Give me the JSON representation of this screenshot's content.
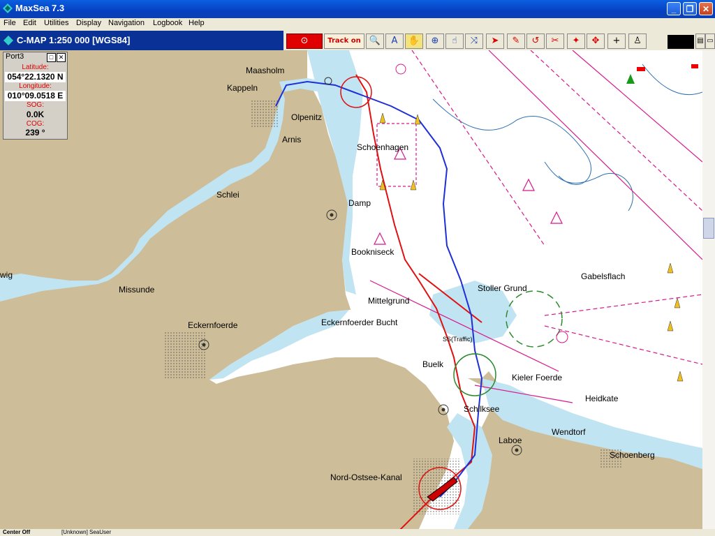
{
  "app": {
    "title": "MaxSea 7.3"
  },
  "menu": [
    "File",
    "Edit",
    "Utilities",
    "Display",
    "Navigation",
    "Logbook",
    "Help"
  ],
  "chart": {
    "header": "C-MAP  1:250 000 [WGS84]"
  },
  "toolbar": {
    "track_label": "Track on"
  },
  "port": {
    "name": "Port3",
    "latitude_label": "Latitude:",
    "latitude": "054°22.1320 N",
    "longitude_label": "Longitude:",
    "longitude": "010°09.0518 E",
    "sog_label": "SOG:",
    "sog": "0.0K",
    "cog_label": "COG:",
    "cog": "239 °"
  },
  "places": [
    "Maasholm",
    "Kappeln",
    "Olpenitz",
    "Arnis",
    "Schoenhagen",
    "Schlei",
    "Damp",
    "Bookniseck",
    "Missunde",
    "Eckernfoerde",
    "Mittelgrund",
    "Eckernfoerder Bucht",
    "Stoller Grund",
    "Gabelsflach",
    "Buelk",
    "Kieler Foerde",
    "Heidkate",
    "Schilksee",
    "Wendtorf",
    "Laboe",
    "Schoenberg",
    "Nord-Ostsee-Kanal",
    "wig",
    "SS(Traffic)"
  ],
  "status": {
    "left": "Center Off",
    "user": "[Unknown] SeaUser"
  },
  "colors": {
    "land": "#cdbd98",
    "deep": "#ffffff",
    "shallow": "#c1e4f2",
    "route_blue": "#1f2fd8",
    "route_red": "#e01010",
    "limits": "#d8188c"
  }
}
